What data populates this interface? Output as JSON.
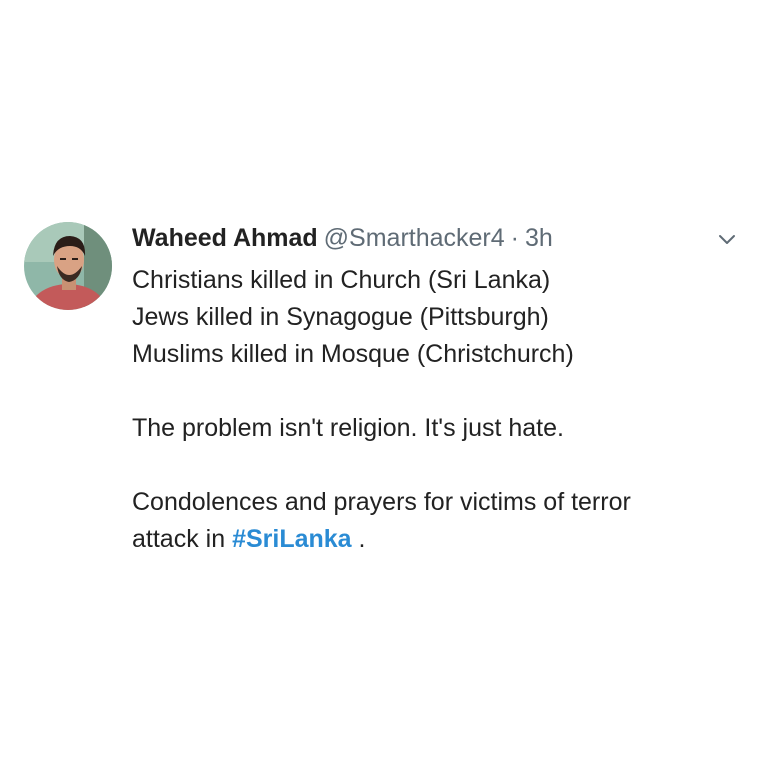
{
  "tweet": {
    "author": {
      "display_name": "Waheed Ahmad",
      "handle": "@Smarthacker4"
    },
    "separator": "·",
    "time": "3h",
    "icons": {
      "menu": "chevron-down-icon",
      "avatar": "user-avatar"
    },
    "lines": [
      "Christians killed in Church (Sri Lanka)",
      "Jews killed in Synagogue (Pittsburgh)",
      "Muslims killed in Mosque (Christchurch)"
    ],
    "statement": "The problem isn't religion. It's just hate.",
    "closing": {
      "line1": "Condolences and prayers for victims of terror",
      "line2_prefix": "attack in ",
      "hashtag": "#SriLanka",
      "line2_suffix": " ."
    }
  },
  "colors": {
    "hashtag": "#2a8bd4",
    "secondary_text": "#5f6b75",
    "primary_text": "#222222"
  }
}
